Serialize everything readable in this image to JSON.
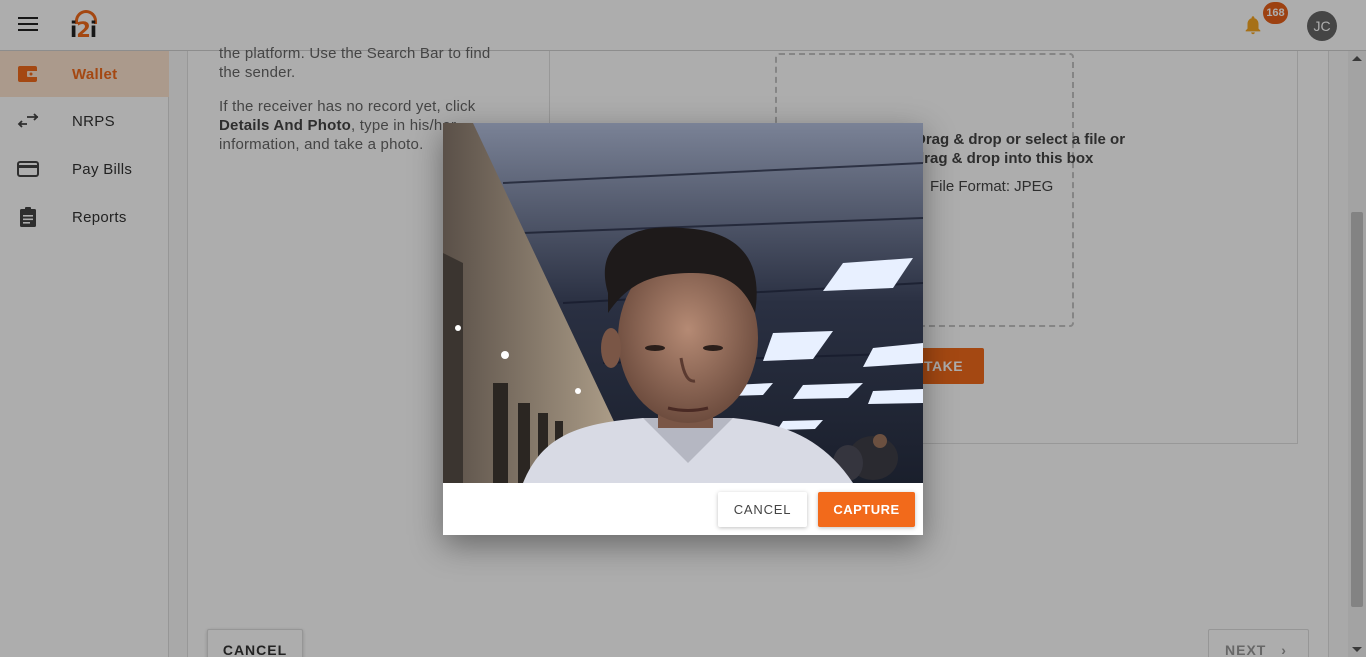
{
  "header": {
    "logo_prefix": "i",
    "logo_accent": "2",
    "logo_suffix": "i",
    "notification_count": "168",
    "avatar_initials": "JC"
  },
  "sidebar": {
    "items": [
      {
        "label": "Wallet",
        "icon": "wallet-icon",
        "active": true
      },
      {
        "label": "NRPS",
        "icon": "transfer-arrows-icon",
        "active": false
      },
      {
        "label": "Pay Bills",
        "icon": "credit-card-icon",
        "active": false
      },
      {
        "label": "Reports",
        "icon": "clipboard-icon",
        "active": false
      }
    ]
  },
  "main": {
    "instructions": {
      "line1": "the platform. Use the Search Bar to find",
      "line2": "the sender.",
      "line3": "If the receiver has no record yet, click",
      "bold": "Details And Photo",
      "line4_rest": ", type in his/her",
      "line5": "information, and take a photo."
    },
    "dropzone": {
      "line1": "Drag & drop or select a file or",
      "line2": "drag & drop into this box",
      "format": "File Format: JPEG"
    },
    "photo_button": "TAKE PHOTO",
    "cancel_button": "CANCEL",
    "next_button": "NEXT"
  },
  "dialog": {
    "cancel_label": "CANCEL",
    "capture_label": "CAPTURE"
  },
  "colors": {
    "accent": "#f26a1b",
    "active_bg": "#fde3cf"
  }
}
